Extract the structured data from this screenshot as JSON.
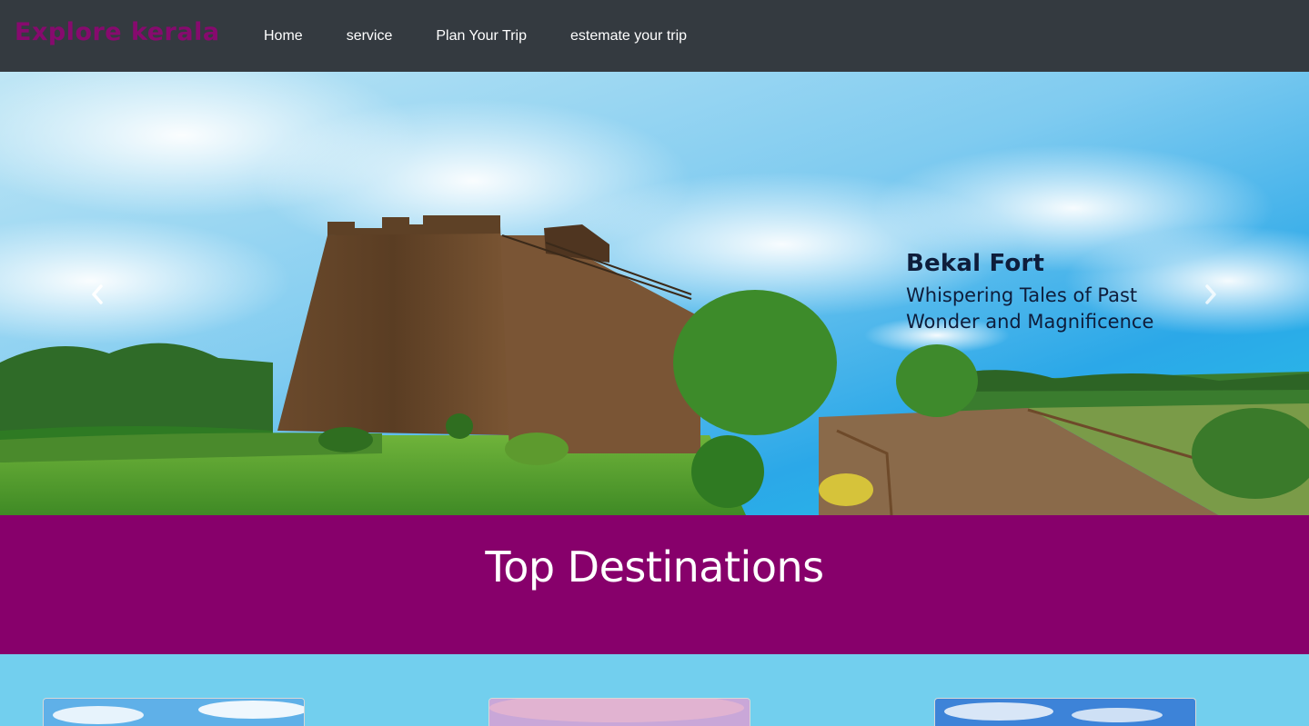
{
  "navbar": {
    "brand": "Explore kerala",
    "links": [
      "Home",
      "service",
      "Plan Your Trip",
      "estemate your trip"
    ]
  },
  "carousel": {
    "slide": {
      "title": "Bekal Fort",
      "subtitle_line1": "Whispering Tales of Past",
      "subtitle_line2": "Wonder and Magnificence"
    },
    "prev_icon": "chevron-left-icon",
    "next_icon": "chevron-right-icon"
  },
  "destinations": {
    "heading": "Top Destinations",
    "cards": [
      {
        "image": "sky-landscape"
      },
      {
        "image": "pink-sky-landscape"
      },
      {
        "image": "blue-sky-landscape"
      }
    ]
  },
  "colors": {
    "navbar_bg": "#343a40",
    "brand": "#870a6e",
    "band_bg": "#87006b",
    "section_bg": "#72cfee"
  }
}
